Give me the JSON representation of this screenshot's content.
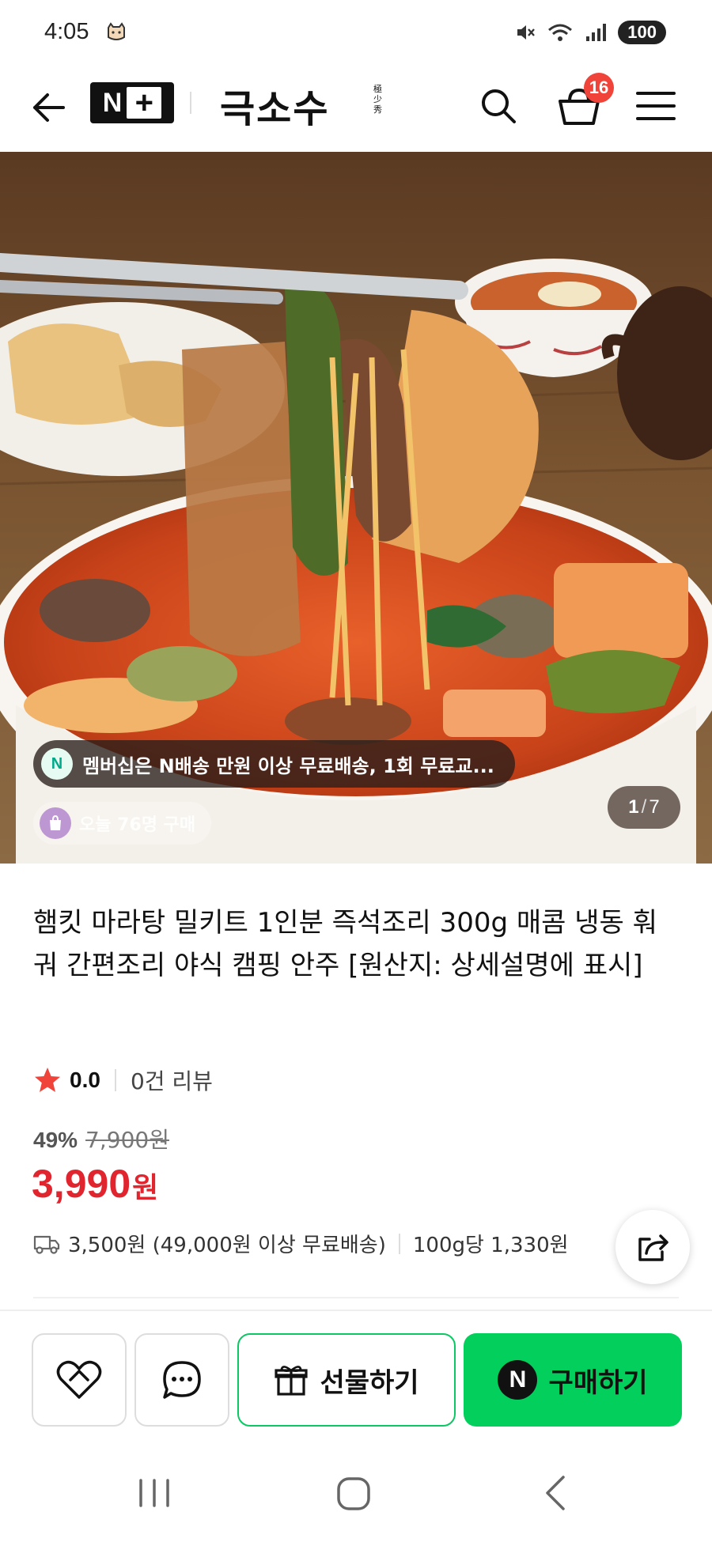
{
  "status_bar": {
    "time": "4:05",
    "battery": "100"
  },
  "header": {
    "badge_text": "N",
    "brand_title": "극소수",
    "brand_hanja": "極少秀",
    "cart_count": "16"
  },
  "hero": {
    "promo_icon_text": "N",
    "promo_text": "멤버십은 N배송 만원 이상 무료배송, 1회 무료교...",
    "today_buyers": "오늘 76명 구매",
    "image_index": "1",
    "image_total": "7"
  },
  "product": {
    "title": "햄킷 마라탕 밀키트 1인분 즉석조리 300g 매콤 냉동 훠궈 간편조리 야식 캠핑 안주 [원산지: 상세설명에 표시]",
    "rating": "0.0",
    "review_count": "0건 리뷰",
    "discount_rate": "49%",
    "original_price": "7,900원",
    "sale_price": "3,990",
    "price_unit": "원",
    "shipping_fee": "3,500원 (49,000원 이상 무료배송)",
    "unit_price": "100g당 1,330원"
  },
  "actions": {
    "gift_label": "선물하기",
    "buy_label": "구매하기",
    "buy_icon_text": "N"
  },
  "colors": {
    "brand_green": "#03cf5d",
    "price_red": "#e0252f",
    "badge_red": "#f0433a"
  }
}
